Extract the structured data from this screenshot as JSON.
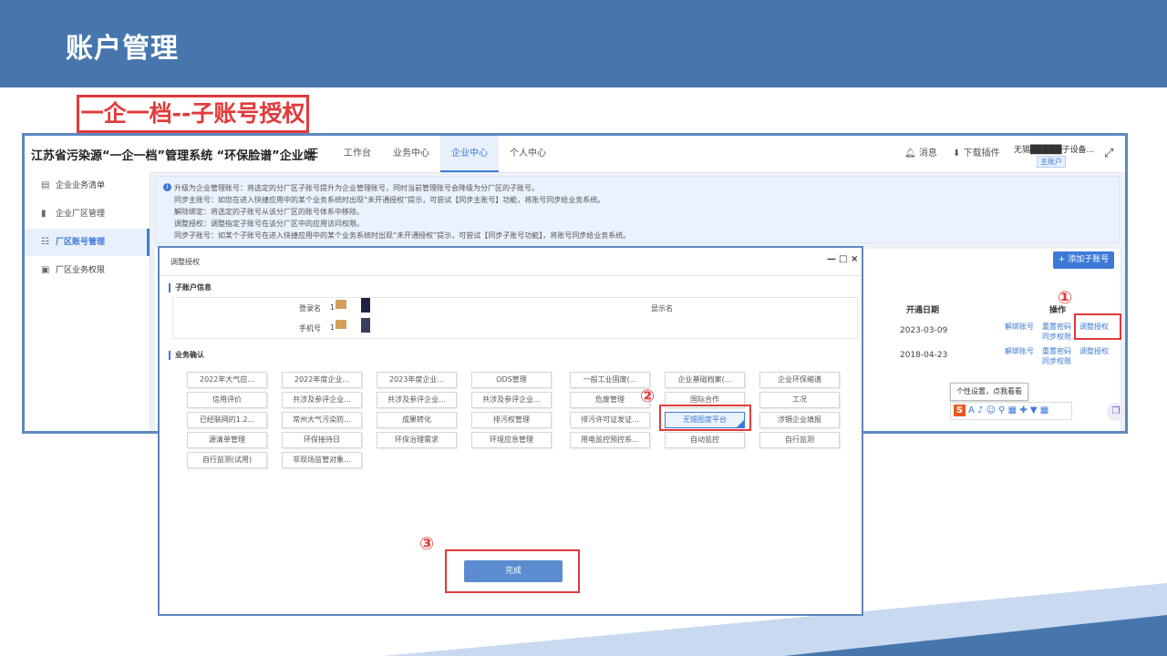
{
  "slide": {
    "title": "账户管理",
    "section_label": "一企一档--子账号授权"
  },
  "app": {
    "system_title": "江苏省污染源“一企一档”管理系统 “环保脸谱”企业端",
    "nav": [
      {
        "label": "工作台"
      },
      {
        "label": "业务中心"
      },
      {
        "label": "企业中心",
        "active": true
      },
      {
        "label": "个人中心"
      }
    ],
    "messages_label": "消息",
    "download_label": "下载插件",
    "user_name": "无锡█████子设备...",
    "user_badge": "主账户"
  },
  "sidebar": {
    "items": [
      {
        "label": "企业业务清单"
      },
      {
        "label": "企业厂区管理"
      },
      {
        "label": "厂区账号管理",
        "active": true
      },
      {
        "label": "厂区业务权限"
      }
    ]
  },
  "info": {
    "lines": [
      "升级为企业管理账号：将选定的分厂区子账号提升为企业管理账号，同时当前管理账号会降级为分厂区的子账号。",
      "同步主账号：如您在进入快捷应用中的某个业务系统时出现“未开通授权”提示，可尝试【同步主账号】功能，将账号同步给业务系统。",
      "解除绑定：将选定的子账号从该分厂区的账号体系中移除。",
      "调整授权：调整指定子账号在该分厂区中的应用访问权限。",
      "同步子账号：如某个子账号在进入快捷应用中的某个业务系统时出现“未开通授权”提示，可尝试【同步子账号功能】，将账号同步给业务系统。"
    ]
  },
  "table": {
    "add_button": "添加子账号",
    "headers": {
      "open_date": "开通日期",
      "operation": "操作"
    },
    "rows": [
      {
        "open_date": "2023-03-09",
        "ops": [
          "解绑账号",
          "重置密码",
          "调整授权",
          "同步权限"
        ]
      },
      {
        "open_date": "2018-04-23",
        "ops": [
          "解绑账号",
          "重置密码",
          "调整授权",
          "同步权限"
        ]
      }
    ]
  },
  "tooltip": "个性设置，点我看看",
  "ime_icons": "A ♪ ☺ ⚲ ▦ ✚ ▼ ▦",
  "markers": [
    "①",
    "②",
    "③"
  ],
  "modal": {
    "title": "调整授权",
    "controls": [
      "—",
      "□",
      "×"
    ],
    "account_section": "子账户信息",
    "labels": {
      "login_name": "登录名",
      "display_name": "显示名",
      "phone": "手机号"
    },
    "values": {
      "login_name": "1",
      "phone": "1"
    },
    "business_section": "业务确认",
    "tags": [
      [
        "2022年大气应...",
        "2022年度企业...",
        "2023年度企业...",
        "ODS管理",
        "一般工业固废(...",
        "企业基础档案(...",
        "企业环保缩谱"
      ],
      [
        "信用评价",
        "共涉及参评企业...",
        "共涉及参评企业...",
        "共涉及参评企业...",
        "危废管理",
        "国际合作",
        "工况"
      ],
      [
        "已经联网的1.2...",
        "常州大气污染防...",
        "成果转化",
        "排污权管理",
        "排污许可证发证...",
        "无锡图度平台",
        "涉镉企业填报"
      ],
      [
        "源清单管理",
        "环保接待日",
        "环保治理需求",
        "环境应急管理",
        "用电监控预控系...",
        "自动监控",
        "自行监测"
      ],
      [
        "自行监测(试用)",
        "非现场监管对象..."
      ]
    ],
    "selected_tag": "无锡图度平台",
    "done_button": "完成"
  }
}
